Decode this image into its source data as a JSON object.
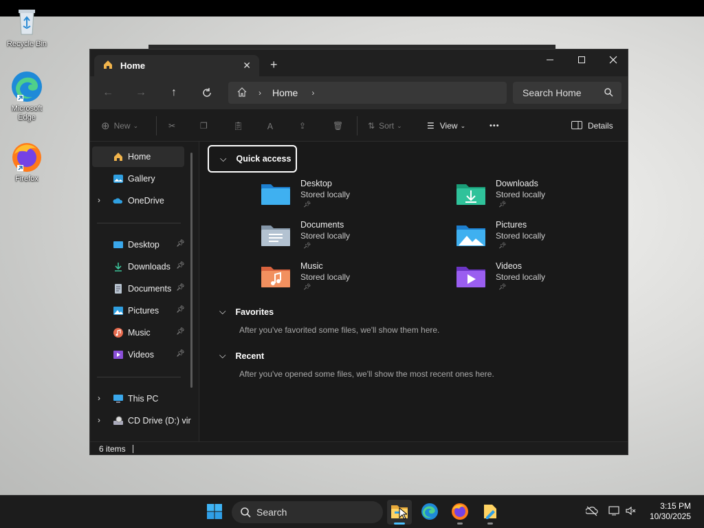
{
  "desktop": {
    "icons": [
      {
        "label_line1": "Recycle Bin",
        "label_line2": ""
      },
      {
        "label_line1": "Microsoft",
        "label_line2": "Edge"
      },
      {
        "label_line1": "Firefox",
        "label_line2": ""
      }
    ]
  },
  "window": {
    "tab_title": "Home",
    "new_tab_symbol": "+",
    "breadcrumb": [
      "Home"
    ],
    "search_placeholder": "Search Home",
    "toolbar": {
      "new_label": "New",
      "sort_label": "Sort",
      "view_label": "View",
      "more_label": "•••",
      "details_label": "Details"
    },
    "sidebar": {
      "top": [
        {
          "label": "Home"
        },
        {
          "label": "Gallery"
        },
        {
          "label": "OneDrive"
        }
      ],
      "pinned": [
        {
          "label": "Desktop"
        },
        {
          "label": "Downloads"
        },
        {
          "label": "Documents"
        },
        {
          "label": "Pictures"
        },
        {
          "label": "Music"
        },
        {
          "label": "Videos"
        }
      ],
      "bottom": [
        {
          "label": "This PC"
        },
        {
          "label": "CD Drive (D:) vir"
        }
      ]
    },
    "quick_access": {
      "title": "Quick access",
      "items": [
        {
          "name": "Desktop",
          "status": "Stored locally"
        },
        {
          "name": "Downloads",
          "status": "Stored locally"
        },
        {
          "name": "Documents",
          "status": "Stored locally"
        },
        {
          "name": "Pictures",
          "status": "Stored locally"
        },
        {
          "name": "Music",
          "status": "Stored locally"
        },
        {
          "name": "Videos",
          "status": "Stored locally"
        }
      ]
    },
    "favorites": {
      "title": "Favorites",
      "message": "After you've favorited some files, we'll show them here."
    },
    "recent": {
      "title": "Recent",
      "message": "After you've opened some files, we'll show the most recent ones here."
    },
    "status_bar": {
      "items_count": "6 items"
    }
  },
  "taskbar": {
    "search_label": "Search",
    "time": "3:15 PM",
    "date": "10/30/2025"
  },
  "colors": {
    "window_bg": "#191919",
    "accent": "#4cc2ff",
    "folder_blue": "#2f9fe0"
  }
}
